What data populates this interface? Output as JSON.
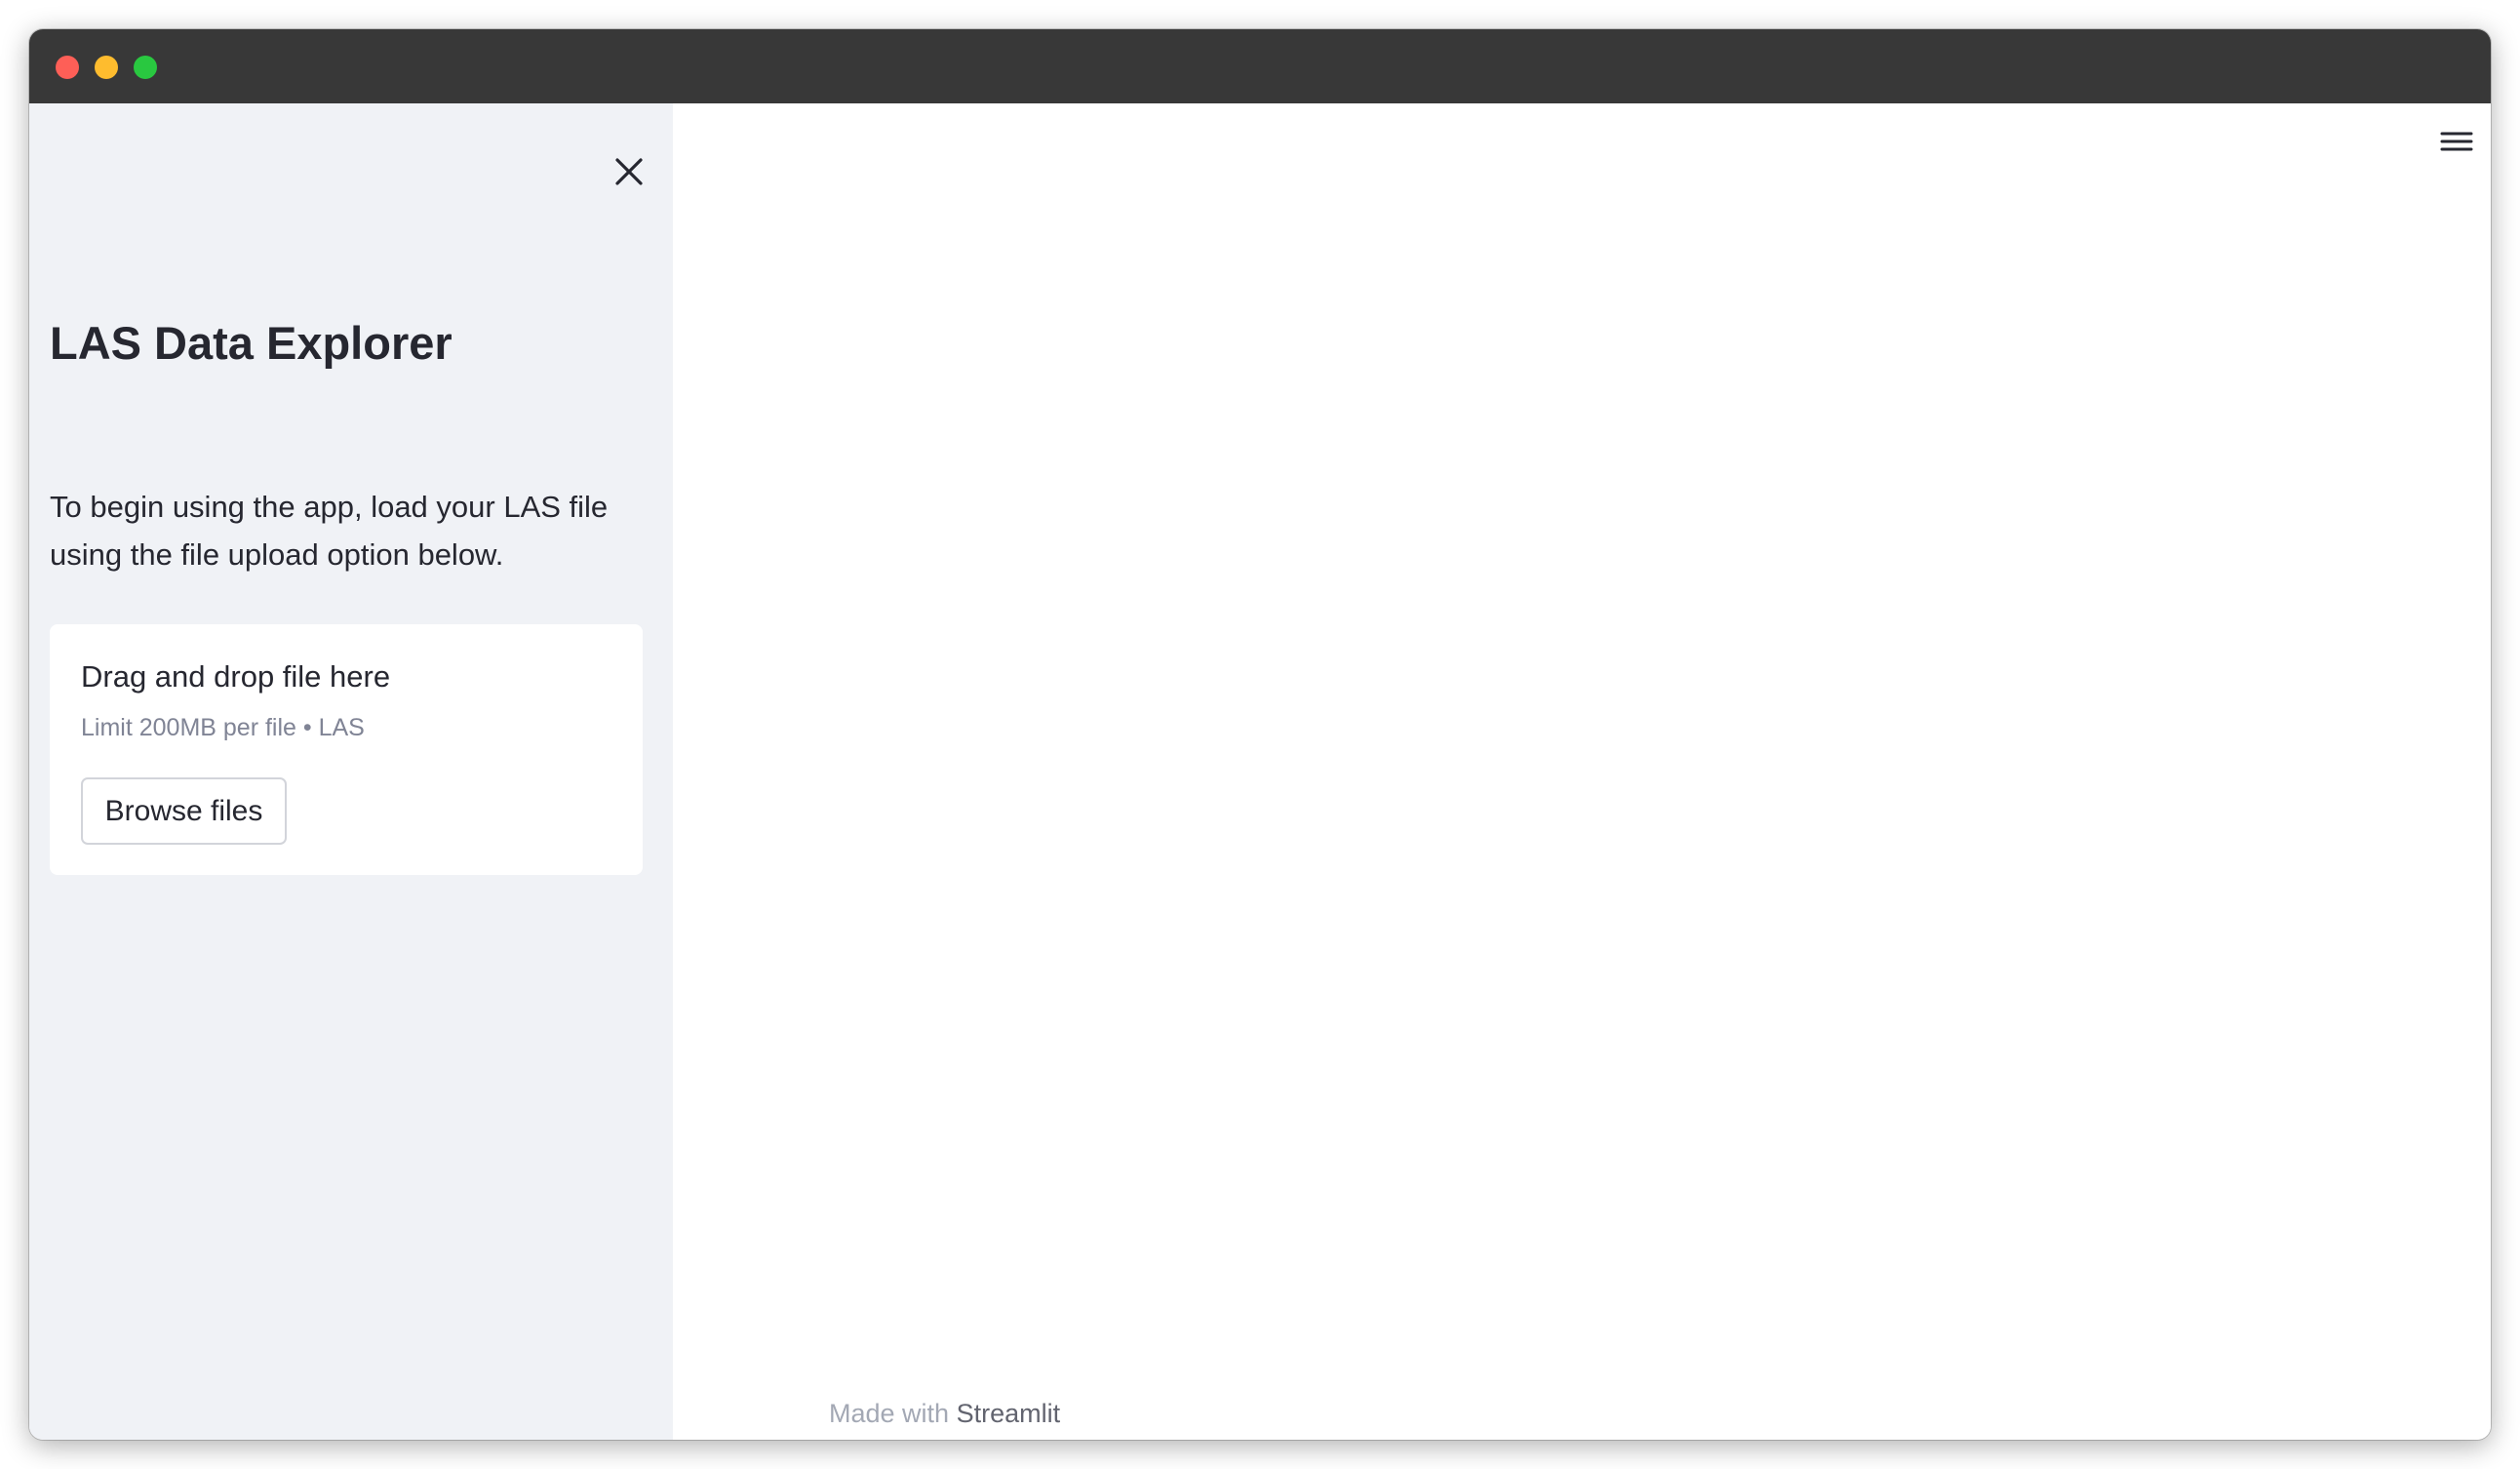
{
  "window": {
    "traffic_lights": [
      "close",
      "minimize",
      "maximize"
    ]
  },
  "sidebar": {
    "close_icon": "close-icon",
    "title": "LAS Data Explorer",
    "intro": "To begin using the app, load your LAS file using the file upload option below.",
    "uploader": {
      "drop_label": "Drag and drop file here",
      "limit_label": "Limit 200MB per file • LAS",
      "browse_label": "Browse files"
    }
  },
  "main": {
    "menu_icon": "hamburger-menu-icon"
  },
  "footer": {
    "prefix": "Made with ",
    "link": "Streamlit"
  },
  "colors": {
    "titlebar": "#383838",
    "sidebar_bg": "#f0f2f6",
    "text": "#262730",
    "muted_text": "#808495",
    "close_light": "#fe5f57",
    "minimize_light": "#febc2e",
    "maximize_light": "#29c840"
  }
}
